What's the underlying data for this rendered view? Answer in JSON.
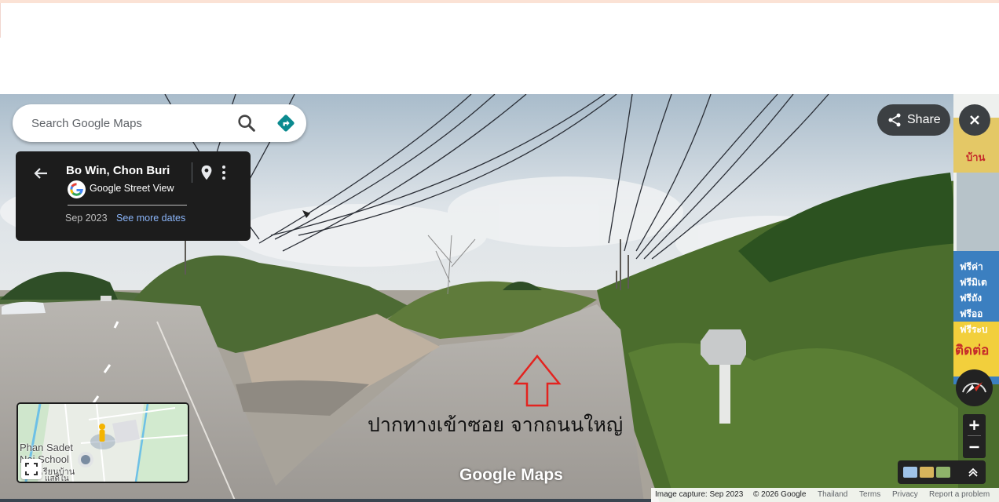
{
  "search": {
    "placeholder": "Search Google Maps"
  },
  "place_card": {
    "title": "Bo Win, Chon Buri",
    "source": "Google Street View",
    "date": "Sep 2023",
    "more_dates": "See more dates"
  },
  "share": {
    "label": "Share"
  },
  "minimap": {
    "labels": [
      "Phan Sadet",
      "Nai School",
      "เรียนบ้าน",
      "แสดีใน"
    ]
  },
  "scene": {
    "watermark": "Google Maps",
    "overlay_text": "ปากทางเข้าซอย  จากถนนใหญ่",
    "sign_texts": [
      "บ้าน",
      "ฟรีค่า",
      "ฟรีมิเต",
      "ฟรีถัง",
      "ฟรีออ",
      "ฟรีระบ",
      "ติดต่อ"
    ]
  },
  "footer": {
    "image_capture": "Image capture: Sep 2023",
    "copyright": "© 2026 Google",
    "country": "Thailand",
    "terms": "Terms",
    "privacy": "Privacy",
    "report": "Report a problem"
  },
  "colors": {
    "card_bg": "#1c1c1c",
    "link": "#8ab4f8",
    "directions": "#0b8a8f",
    "overlay_arrow": "#e3231f"
  },
  "icons": [
    "search-icon",
    "directions-icon",
    "arrow-back-icon",
    "location-pin-icon",
    "more-vert-icon",
    "google-logo-icon",
    "share-icon",
    "close-icon",
    "compass-icon",
    "plus-icon",
    "minus-icon",
    "expand-up-icon",
    "fullscreen-icon",
    "pegman-icon"
  ]
}
